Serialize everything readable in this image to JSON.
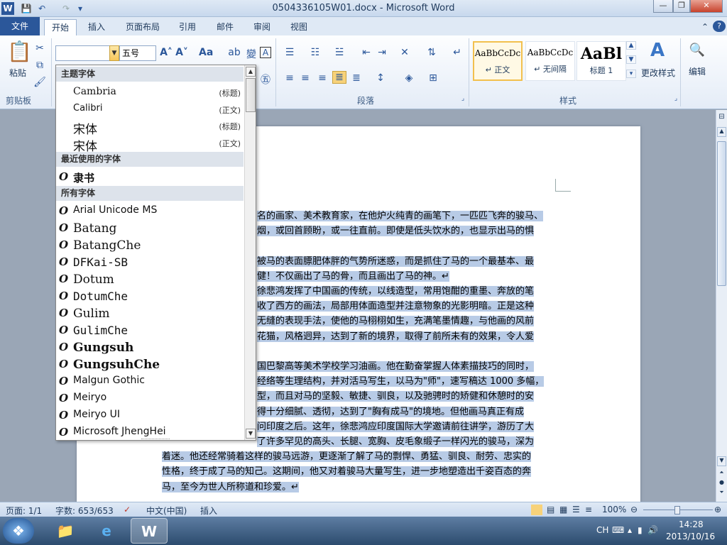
{
  "window": {
    "title": "0504336105W01.docx - Microsoft Word",
    "controls": [
      "—",
      "❐",
      "✕"
    ]
  },
  "quick_access": [
    "W",
    "💾",
    "↶",
    "↷",
    "▾"
  ],
  "tabs": [
    {
      "label": "文件",
      "active": false
    },
    {
      "label": "开始",
      "active": true
    },
    {
      "label": "插入",
      "active": false
    },
    {
      "label": "页面布局",
      "active": false
    },
    {
      "label": "引用",
      "active": false
    },
    {
      "label": "邮件",
      "active": false
    },
    {
      "label": "审阅",
      "active": false
    },
    {
      "label": "视图",
      "active": false
    }
  ],
  "ribbon": {
    "clipboard": {
      "paste": "粘贴",
      "label": "剪贴板"
    },
    "font": {
      "size": "五号",
      "grow": "A˄",
      "shrink": "A˅",
      "case": "Aa"
    },
    "paragraph": {
      "label": "段落"
    },
    "styles": {
      "label": "样式",
      "items": [
        {
          "preview": "AaBbCcDc",
          "name": "↵ 正文",
          "selected": true
        },
        {
          "preview": "AaBbCcDc",
          "name": "↵ 无间隔",
          "selected": false
        },
        {
          "preview": "AaBl",
          "name": "标题 1",
          "selected": false
        }
      ],
      "change": "更改样式"
    },
    "editing": {
      "label": "编辑"
    }
  },
  "font_dropdown": {
    "theme_header": "主题字体",
    "theme_fonts": [
      {
        "name": "Cambria",
        "tag": "(标题)"
      },
      {
        "name": "Calibri",
        "tag": "(正文)"
      },
      {
        "name": "宋体",
        "tag": "(标题)"
      },
      {
        "name": "宋体",
        "tag": "(正文)"
      }
    ],
    "recent_header": "最近使用的字体",
    "recent_fonts": [
      "隶书"
    ],
    "all_header": "所有字体",
    "all_fonts": [
      "Arial Unicode MS",
      "Batang",
      "BatangChe",
      "DFKai-SB",
      "Dotum",
      "DotumChe",
      "Gulim",
      "GulimChe",
      "Gungsuh",
      "GungsuhChe",
      "Malgun Gothic",
      "Meiryo",
      "Meiryo UI",
      "Microsoft JhengHei"
    ],
    "font_icon": "O"
  },
  "document": {
    "lines": [
      "名的画家、美术教育家，在他炉火纯青的画笔下，一匹匹飞奔的骏马、",
      "烟，或回首顾盼，或一往直前。即使是低头饮水的，也显示出马的惧",
      "",
      "被马的表面膘肥体胖的气势所迷惑，而是抓住了马的一个最基本、最",
      "健！不仅画出了马的骨，而且画出了马的神。↵",
      "徐悲鸿发挥了中国画的传统，以线造型，常用饱酣的重墨、奔放的笔",
      "收了西方的画法，局部用体面造型并注意物象的光影明暗。正是这种",
      "无缝的表现手法，使他的马栩栩如生，充满笔墨情趣，与他画的风前",
      "花猫，风格迥异，达到了新的境界，取得了前所未有的效果，令人爱",
      "",
      "国巴黎高等美术学校学习油画。他在勤奋掌握人体素描技巧的同时，",
      "经络等生理结构，并对活马写生，以马为\"师\"，速写稿达 1000 多幅，",
      "型，而且对马的坚毅、敏捷、驯良，以及驰骋时的矫健和休憩时的安",
      "得十分细腻、透彻，达到了\"胸有成马\"的境地。但他画马真正有成",
      "问印度之后。这年，徐悲鸿应印度国际大学邀请前往讲学，游历了大",
      "了许多罕见的高头、长腿、宽胸、皮毛象缎子一样闪光的骏马，深为",
      "着迷。他还经常骑着这样的骏马远游，更逐渐了解了马的剽悍、勇猛、驯良、耐劳、忠实的",
      "性格，终于成了马的知己。这期间，他又对着骏马大量写生，进一步地塑造出千姿百态的奔",
      "马，至今为世人所称道和珍爱。↵"
    ]
  },
  "statusbar": {
    "page": "页面: 1/1",
    "words": "字数: 653/653",
    "language": "中文(中国)",
    "mode": "插入",
    "zoom": "100%"
  },
  "taskbar": {
    "ime": "CH",
    "time": "14:28",
    "date": "2013/10/16"
  },
  "colors": {
    "accent": "#2b579a",
    "selection": "#b8cbe6",
    "style_selected": "#f2c04e"
  }
}
